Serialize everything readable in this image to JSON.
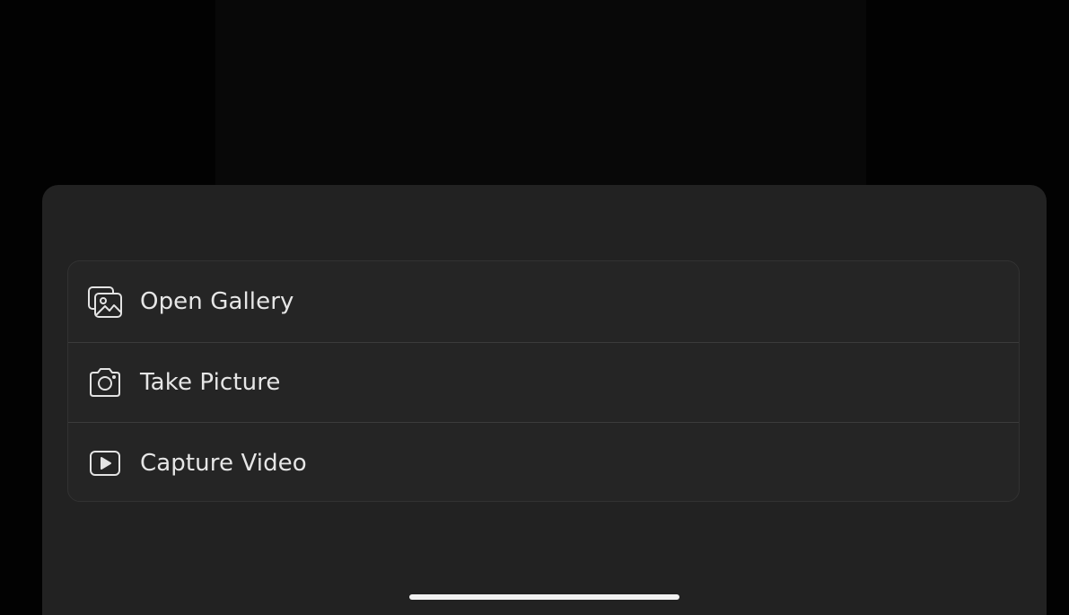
{
  "sheet": {
    "items": [
      {
        "label": "Open Gallery",
        "icon": "gallery-icon"
      },
      {
        "label": "Take Picture",
        "icon": "camera-icon"
      },
      {
        "label": "Capture Video",
        "icon": "video-icon"
      }
    ]
  },
  "colors": {
    "background": "#050505",
    "sheet": "#222222",
    "menu": "#252525",
    "text": "#e6e6e6",
    "divider": "#3b3b3b"
  }
}
